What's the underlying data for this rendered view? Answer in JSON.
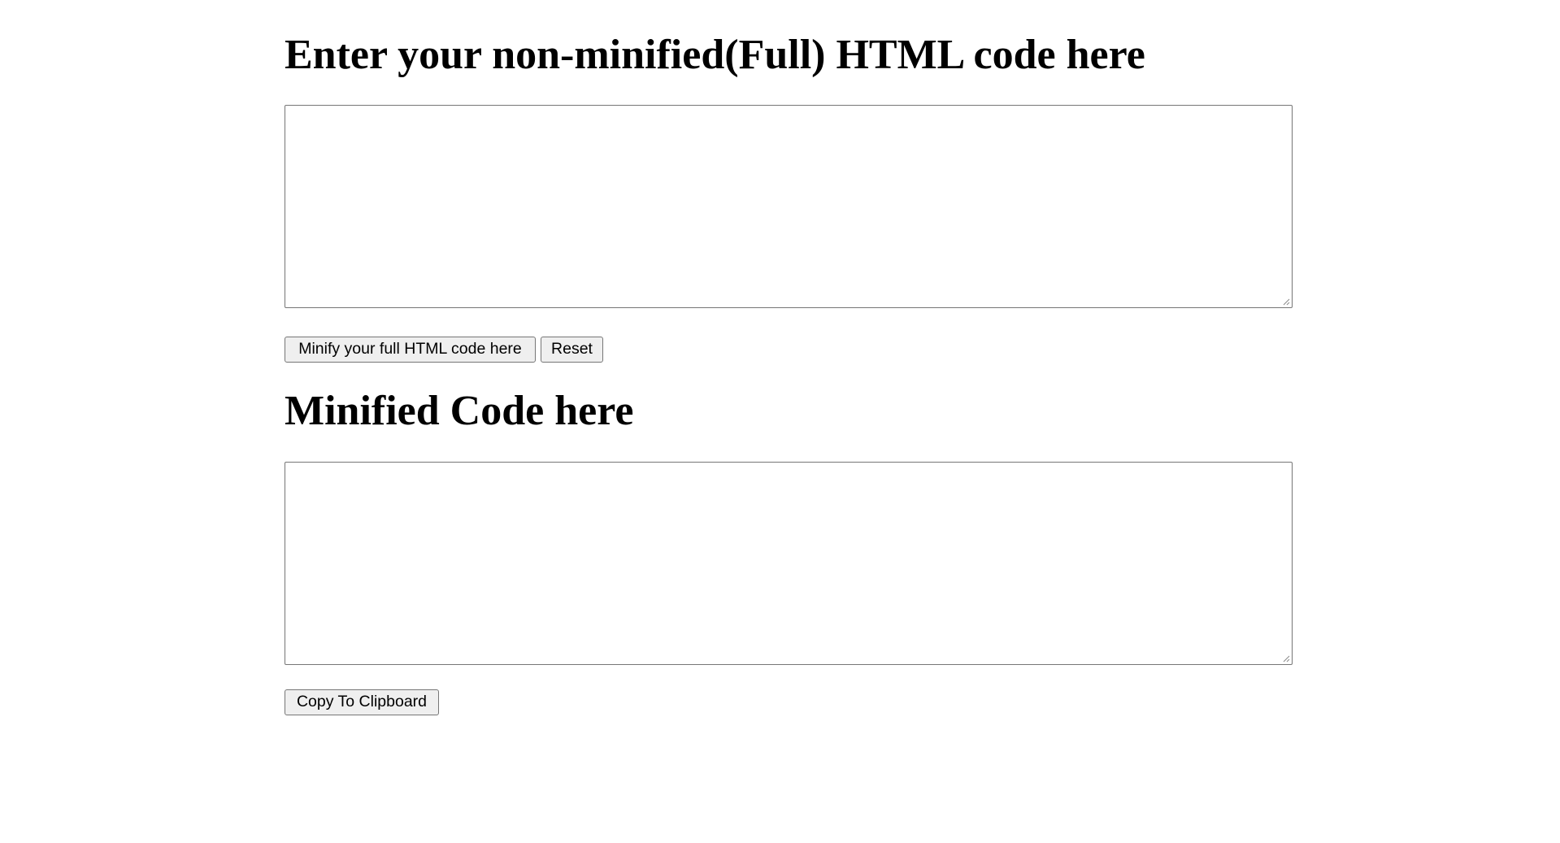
{
  "input_section": {
    "heading": "Enter your non-minified(Full) HTML code here",
    "textarea_value": "",
    "minify_button_label": "Minify your full HTML code here",
    "reset_button_label": "Reset"
  },
  "output_section": {
    "heading": "Minified Code here",
    "textarea_value": "",
    "copy_button_label": "Copy To Clipboard"
  },
  "icons": {
    "resize_grip": "resize-grip-icon"
  }
}
